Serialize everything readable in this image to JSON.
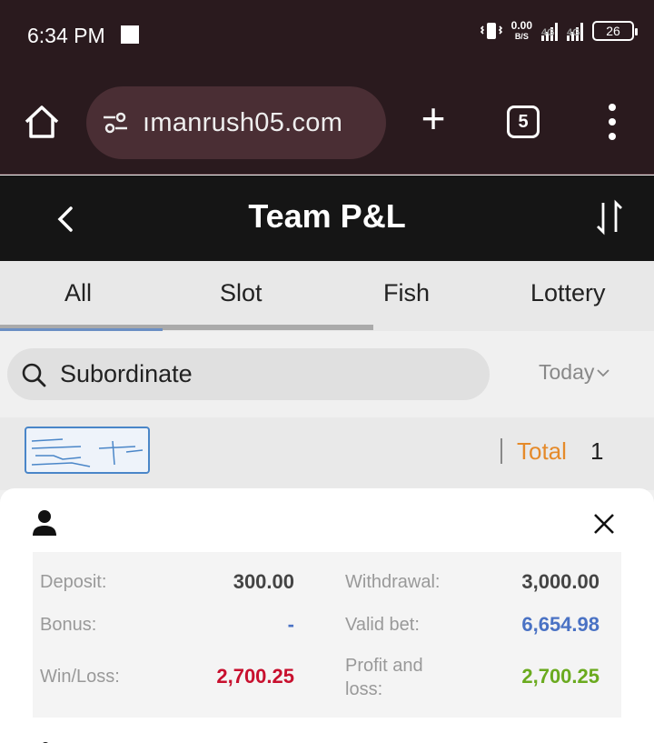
{
  "status_bar": {
    "time": "6:34 PM",
    "net_speed_value": "0.00",
    "net_speed_unit": "B/S",
    "signal1_label": "4G",
    "signal2_label": "4G",
    "battery": "26"
  },
  "browser": {
    "url": "ımanrush05.com",
    "tab_count": "5"
  },
  "header": {
    "title": "Team P&L"
  },
  "tabs": [
    {
      "label": "All",
      "active": true
    },
    {
      "label": "Slot"
    },
    {
      "label": "Fish"
    },
    {
      "label": "Lottery"
    }
  ],
  "filter": {
    "search_placeholder": "Subordinate",
    "date_label": "Today"
  },
  "summary": {
    "total_label": "Total",
    "total_value": "1"
  },
  "detail": {
    "deposit_label": "Deposit:",
    "deposit_value": "300.00",
    "withdrawal_label": "Withdrawal:",
    "withdrawal_value": "3,000.00",
    "bonus_label": "Bonus:",
    "bonus_value": "-",
    "valid_bet_label": "Valid bet:",
    "valid_bet_value": "6,654.98",
    "winloss_label": "Win/Loss:",
    "winloss_value": "2,700.25",
    "pnl_label_line1": "Profit and",
    "pnl_label_line2": "loss:",
    "pnl_value": "2,700.25"
  },
  "colors": {
    "accent_blue": "#4a72c4",
    "loss_red": "#c8102e",
    "profit_green": "#6aaa1e",
    "total_orange": "#e58a2a"
  }
}
